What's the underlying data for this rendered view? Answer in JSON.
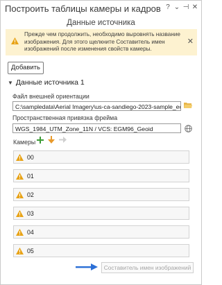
{
  "window": {
    "title": "Построить таблицы камеры и кадров",
    "controls": [
      "?",
      "⌄",
      "⊣",
      "✕"
    ]
  },
  "subtitle": "Данные источника",
  "banner": {
    "text": "Прежде чем продолжить, необходимо выровнять название изображения. Для этого щелкните Составитель имен изображений после изменения свойств камеры.",
    "icon": "warning-icon",
    "color": "#fdf2d0"
  },
  "add_button": "Добавить",
  "section": {
    "title": "Данные источника 1",
    "orientation_label": "Файл внешней ориентации",
    "orientation_value": "C:\\sampledata\\Aerial Imagery\\us-ca-sandiego-2023-sample_eo.txt",
    "spatial_label": "Пространственная привязка фрейма",
    "spatial_value": "WGS_1984_UTM_Zone_11N / VCS: EGM96_Geoid",
    "cameras_label": "Камеры",
    "cameras": [
      "00",
      "01",
      "02",
      "03",
      "04",
      "05"
    ]
  },
  "generate_button": "Составитель имен изображений",
  "colors": {
    "warning": "#e8a317",
    "add": "#3c9b35",
    "arrow_down": "#e89a2c",
    "blue_arrow": "#2b6fd6"
  }
}
